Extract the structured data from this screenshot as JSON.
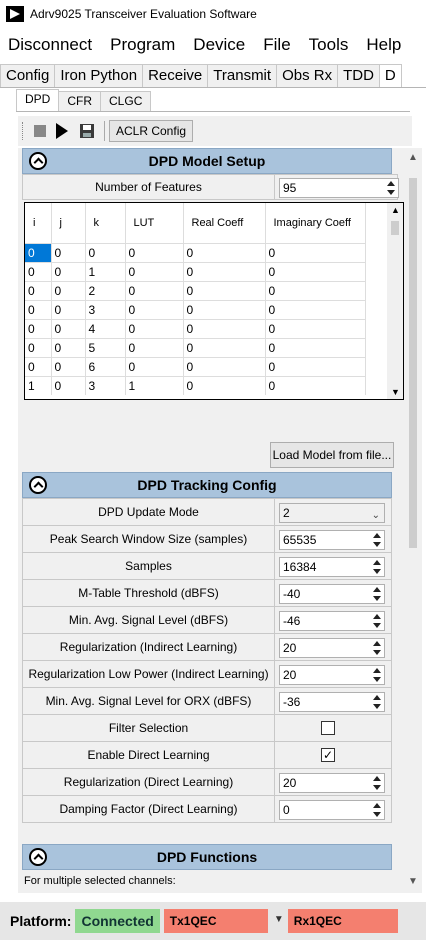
{
  "window": {
    "title": "Adrv9025 Transceiver Evaluation Software"
  },
  "menubar": {
    "items": [
      "Disconnect",
      "Program",
      "Device",
      "File",
      "Tools",
      "Help"
    ]
  },
  "main_tabs": [
    "Config",
    "Iron Python",
    "Receive",
    "Transmit",
    "Obs Rx",
    "TDD",
    "D"
  ],
  "sub_tabs": [
    "DPD",
    "CFR",
    "CLGC"
  ],
  "toolbar": {
    "aclr_label": "ACLR Config"
  },
  "dpd_model": {
    "header": "DPD Model Setup",
    "num_features_label": "Number of Features",
    "num_features_value": "95",
    "columns": [
      "i",
      "j",
      "k",
      "LUT",
      "Real Coeff",
      "Imaginary Coeff"
    ],
    "rows": [
      [
        "0",
        "0",
        "0",
        "0",
        "0",
        "0"
      ],
      [
        "0",
        "0",
        "1",
        "0",
        "0",
        "0"
      ],
      [
        "0",
        "0",
        "2",
        "0",
        "0",
        "0"
      ],
      [
        "0",
        "0",
        "3",
        "0",
        "0",
        "0"
      ],
      [
        "0",
        "0",
        "4",
        "0",
        "0",
        "0"
      ],
      [
        "0",
        "0",
        "5",
        "0",
        "0",
        "0"
      ],
      [
        "0",
        "0",
        "6",
        "0",
        "0",
        "0"
      ],
      [
        "1",
        "0",
        "3",
        "1",
        "0",
        "0"
      ]
    ],
    "load_button": "Load Model from file..."
  },
  "tracking": {
    "header": "DPD Tracking Config",
    "fields": [
      {
        "label": "DPD Update Mode",
        "value": "2",
        "kind": "combo"
      },
      {
        "label": "Peak Search Window Size (samples)",
        "value": "65535",
        "kind": "spin"
      },
      {
        "label": "Samples",
        "value": "16384",
        "kind": "spin"
      },
      {
        "label": "M-Table Threshold (dBFS)",
        "value": "-40",
        "kind": "spin"
      },
      {
        "label": "Min. Avg. Signal Level (dBFS)",
        "value": "-46",
        "kind": "spin"
      },
      {
        "label": "Regularization (Indirect Learning)",
        "value": "20",
        "kind": "spin"
      },
      {
        "label": "Regularization Low Power (Indirect Learning)",
        "value": "20",
        "kind": "spin"
      },
      {
        "label": "Min. Avg. Signal Level for ORX (dBFS)",
        "value": "-36",
        "kind": "spin"
      },
      {
        "label": "Filter Selection",
        "checked": false,
        "kind": "check"
      },
      {
        "label": "Enable Direct Learning",
        "checked": true,
        "kind": "check"
      },
      {
        "label": "Regularization (Direct Learning)",
        "value": "20",
        "kind": "spin"
      },
      {
        "label": "Damping Factor (Direct Learning)",
        "value": "0",
        "kind": "spin"
      }
    ]
  },
  "functions": {
    "header": "DPD Functions",
    "hint": "For multiple selected channels:"
  },
  "status": {
    "platform_label": "Platform:",
    "connection": "Connected",
    "tx": "Tx1QEC",
    "rx": "Rx1QEC",
    "colors": {
      "connected": "#90d890",
      "alert": "#f47f6f",
      "section": "#a9c3dc"
    }
  }
}
